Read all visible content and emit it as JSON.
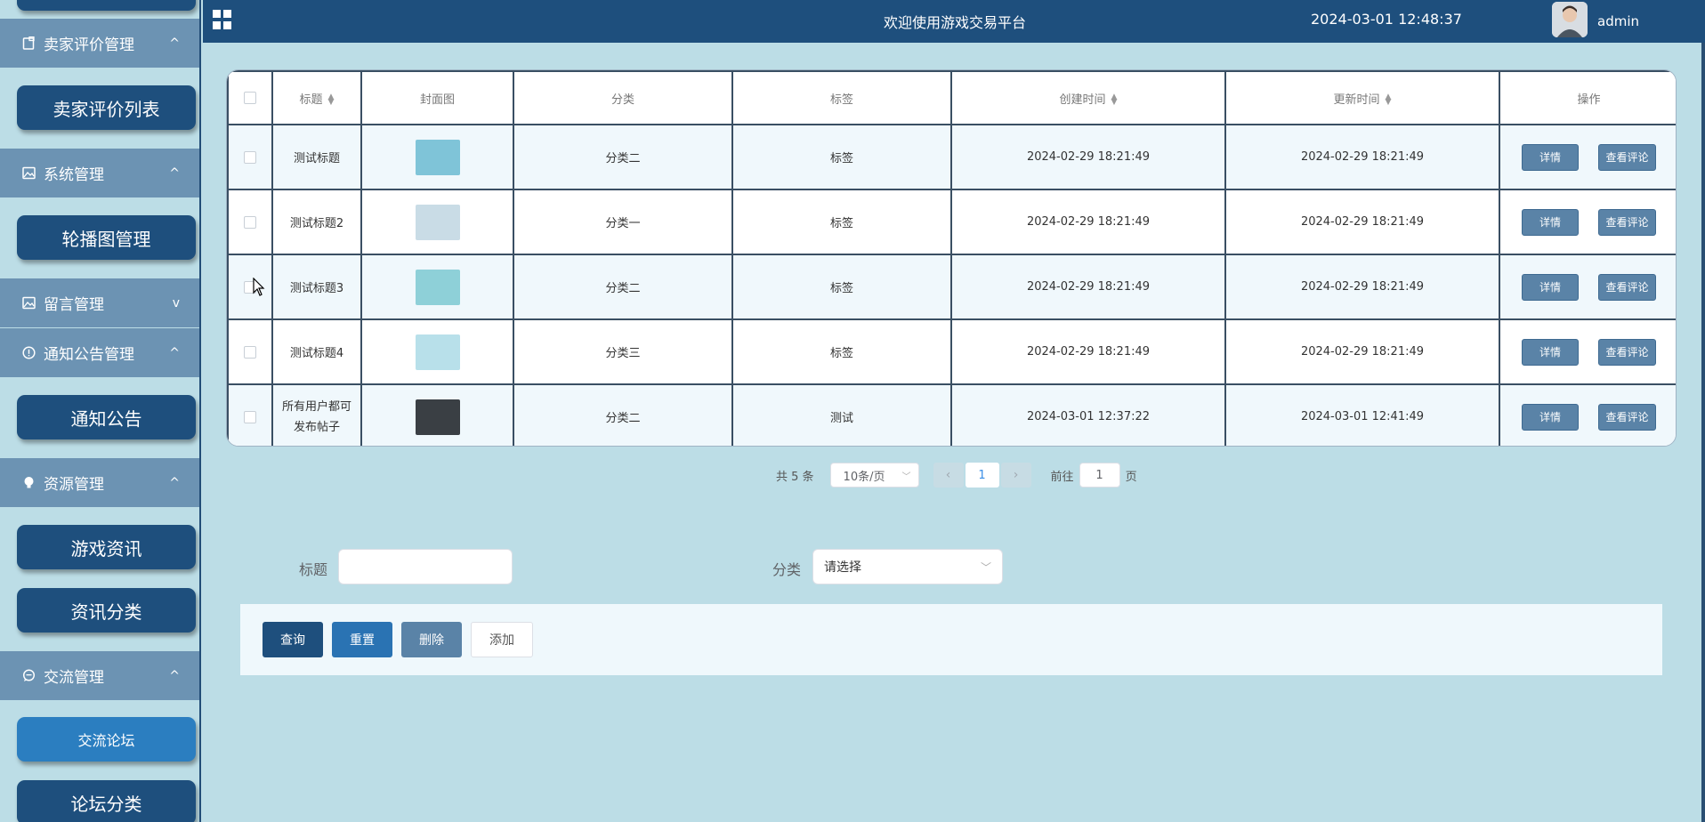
{
  "sidebar": {
    "groups": [
      {
        "label": "卖家评价管理",
        "chevron": "^",
        "icon": "clipboard-icon"
      },
      {
        "label": "系统管理",
        "chevron": "^",
        "icon": "image-icon"
      },
      {
        "label": "留言管理",
        "chevron": "v",
        "icon": "image-icon"
      },
      {
        "label": "通知公告管理",
        "chevron": "^",
        "icon": "alert-circle-icon"
      },
      {
        "label": "资源管理",
        "chevron": "^",
        "icon": "bulb-icon"
      },
      {
        "label": "交流管理",
        "chevron": "^",
        "icon": "chat-icon"
      }
    ],
    "items": [
      {
        "label": "卖家评价列表"
      },
      {
        "label": "轮播图管理"
      },
      {
        "label": "通知公告"
      },
      {
        "label": "游戏资讯"
      },
      {
        "label": "资讯分类"
      },
      {
        "label": "交流论坛"
      },
      {
        "label": "论坛分类"
      }
    ]
  },
  "header": {
    "title": "欢迎使用游戏交易平台",
    "datetime": "2024-03-01 12:48:37",
    "user": "admin"
  },
  "table": {
    "columns": [
      "标题",
      "封面图",
      "分类",
      "标签",
      "创建时间",
      "更新时间",
      "操作"
    ],
    "rows": [
      {
        "title": "测试标题",
        "category": "分类二",
        "tag": "标签",
        "created": "2024-02-29 18:21:49",
        "updated": "2024-02-29 18:21:49",
        "thumb_color": "#7fc4d8"
      },
      {
        "title": "测试标题2",
        "category": "分类一",
        "tag": "标签",
        "created": "2024-02-29 18:21:49",
        "updated": "2024-02-29 18:21:49",
        "thumb_color": "#c9dce6"
      },
      {
        "title": "测试标题3",
        "category": "分类二",
        "tag": "标签",
        "created": "2024-02-29 18:21:49",
        "updated": "2024-02-29 18:21:49",
        "thumb_color": "#8ed0d8"
      },
      {
        "title": "测试标题4",
        "category": "分类三",
        "tag": "标签",
        "created": "2024-02-29 18:21:49",
        "updated": "2024-02-29 18:21:49",
        "thumb_color": "#b8e0ea"
      },
      {
        "title": "所有用户都可发布帖子",
        "category": "分类二",
        "tag": "测试",
        "created": "2024-03-01 12:37:22",
        "updated": "2024-03-01 12:41:49",
        "thumb_color": "#3a3f44"
      }
    ],
    "detail_label": "详情",
    "comment_label": "查看评论"
  },
  "pager": {
    "total": "共 5 条",
    "page_size": "10条/页",
    "current": "1",
    "goto_prefix": "前往",
    "goto_value": "1",
    "goto_suffix": "页"
  },
  "search": {
    "title_label": "标题",
    "title_value": "",
    "category_label": "分类",
    "category_placeholder": "请选择"
  },
  "actions": {
    "query": "查询",
    "reset": "重置",
    "delete": "删除",
    "add": "添加"
  }
}
